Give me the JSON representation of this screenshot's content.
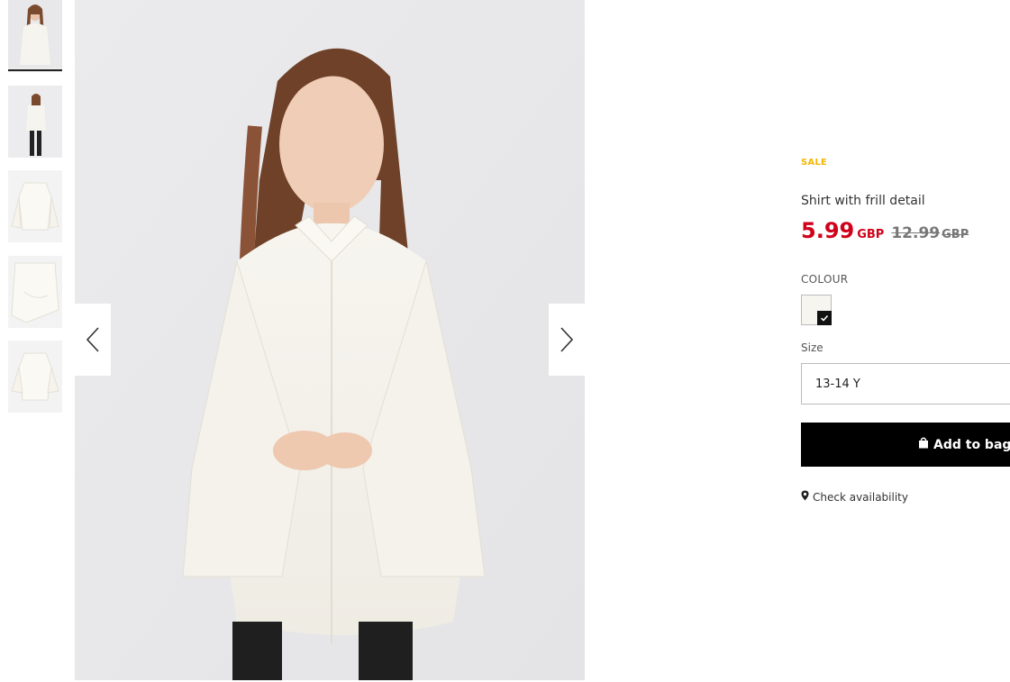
{
  "gallery": {
    "thumbnails": [
      {
        "name": "thumbnail-1",
        "active": true
      },
      {
        "name": "thumbnail-2",
        "active": false
      },
      {
        "name": "thumbnail-3",
        "active": false
      },
      {
        "name": "thumbnail-4",
        "active": false
      },
      {
        "name": "thumbnail-5",
        "active": false
      }
    ],
    "prev_icon": "chevron-left-icon",
    "next_icon": "chevron-right-icon"
  },
  "product": {
    "badge": "SALE",
    "title": "Shirt with frill detail",
    "price_now": "5.99",
    "currency_now": "GBP",
    "price_old": "12.99",
    "currency_old": "GBP",
    "colour_label": "COLOUR",
    "colour_swatch": "#f6f5f0",
    "size_label": "Size",
    "size_selected": "13-14 Y",
    "add_to_bag_label": "Add to bag",
    "check_availability_label": "Check availability"
  },
  "colors": {
    "sale": "#f2b705",
    "price": "#d0021b",
    "button_bg": "#000000"
  }
}
